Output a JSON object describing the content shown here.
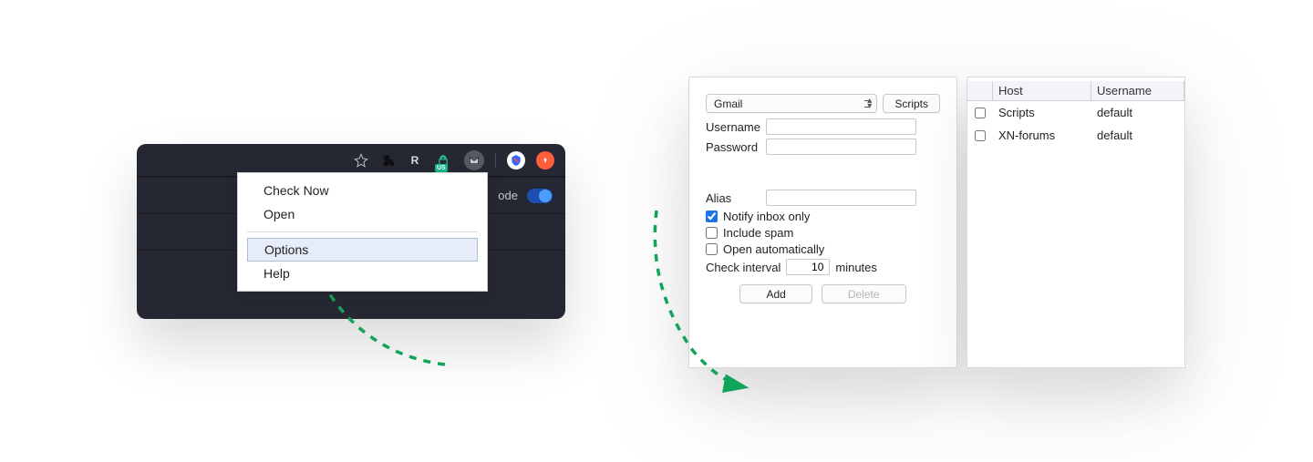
{
  "toolbar": {
    "lock_badge": "US"
  },
  "dark_row": {
    "mode_suffix": "ode"
  },
  "menu": {
    "check_now": "Check Now",
    "open": "Open",
    "options": "Options",
    "help": "Help"
  },
  "options_panel": {
    "provider_selected": "Gmail",
    "scripts_button": "Scripts",
    "username_label": "Username",
    "password_label": "Password",
    "alias_label": "Alias",
    "notify_inbox_only_label": "Notify inbox only",
    "notify_inbox_only_checked": true,
    "include_spam_label": "Include spam",
    "include_spam_checked": false,
    "open_auto_label": "Open automatically",
    "open_auto_checked": false,
    "check_interval_label": "Check interval",
    "check_interval_value": "10",
    "minutes_label": "minutes",
    "add_button": "Add",
    "delete_button": "Delete"
  },
  "accounts_table": {
    "col_host": "Host",
    "col_username": "Username",
    "rows": [
      {
        "host": "Scripts",
        "username": "default",
        "checked": false
      },
      {
        "host": "XN-forums",
        "username": "default",
        "checked": false
      }
    ]
  }
}
